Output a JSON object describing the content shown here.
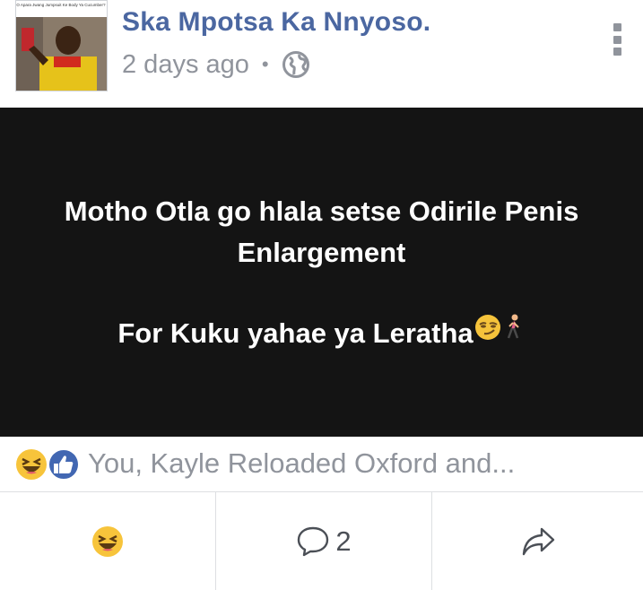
{
  "post": {
    "author": "Ska Mpotsa Ka Nnyoso.",
    "time": "2 days ago",
    "separator": "•",
    "privacy_icon": "globe-icon",
    "avatar_caption": "O Apara Jwang Jumpsuit Ke Body Ya Cucumber?",
    "body_line_1": "Motho Otla go hlala setse Odirile Penis",
    "body_line_2": "Enlargement",
    "body_line_3": "For Kuku yahae ya Leratha"
  },
  "reactions": {
    "icons": [
      "haha-icon",
      "like-icon"
    ],
    "text": "You, Kayle Reloaded Oxford and..."
  },
  "actions": {
    "react_icon": "haha-icon",
    "comment_count": "2",
    "comment_icon": "comment-icon",
    "share_icon": "share-icon"
  },
  "colors": {
    "author": "#4b67a1",
    "meta": "#90949c",
    "post_background": "#141414",
    "like_blue": "#4267b2",
    "haha_yellow": "#f7c43b"
  }
}
